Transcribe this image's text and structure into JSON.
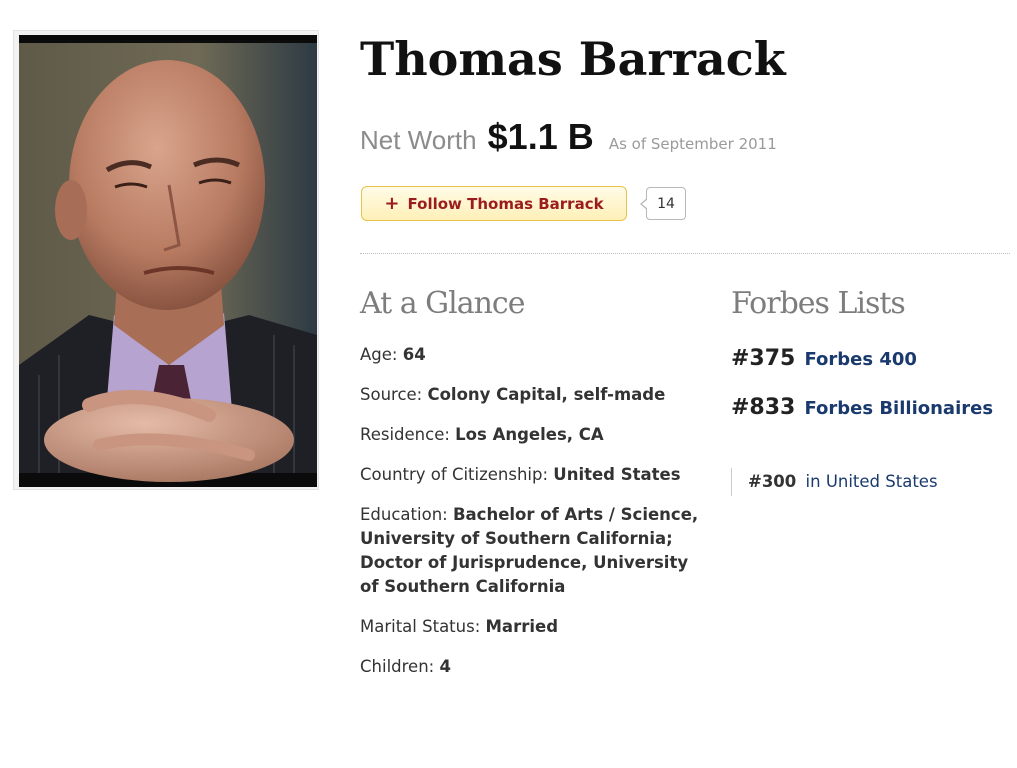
{
  "profile": {
    "name": "Thomas Barrack",
    "net_worth_label": "Net Worth",
    "net_worth_value": "$1.1 B",
    "as_of": "As of September 2011"
  },
  "follow": {
    "icon": "plus-icon",
    "label": "Follow Thomas Barrack",
    "count": "14",
    "accent": "#9b1c1c"
  },
  "glance": {
    "heading": "At a Glance",
    "items": [
      {
        "label": "Age:",
        "value": "64"
      },
      {
        "label": "Source:",
        "value": "Colony Capital, self-made"
      },
      {
        "label": "Residence:",
        "value": "Los Angeles, CA"
      },
      {
        "label": "Country of Citizenship:",
        "value": "United States"
      },
      {
        "label": "Education:",
        "value": "Bachelor of Arts / Science, University of Southern California; Doctor of Jurisprudence, University of Southern California"
      },
      {
        "label": "Marital Status:",
        "value": "Married"
      },
      {
        "label": "Children:",
        "value": "4"
      }
    ]
  },
  "forbes_lists": {
    "heading": "Forbes Lists",
    "link_color": "#1a3a6e",
    "entries": [
      {
        "rank": "#375",
        "list": "Forbes 400"
      },
      {
        "rank": "#833",
        "list": "Forbes Billionaires"
      }
    ],
    "sub_rank": {
      "rank": "#300",
      "text": "in United States"
    }
  }
}
